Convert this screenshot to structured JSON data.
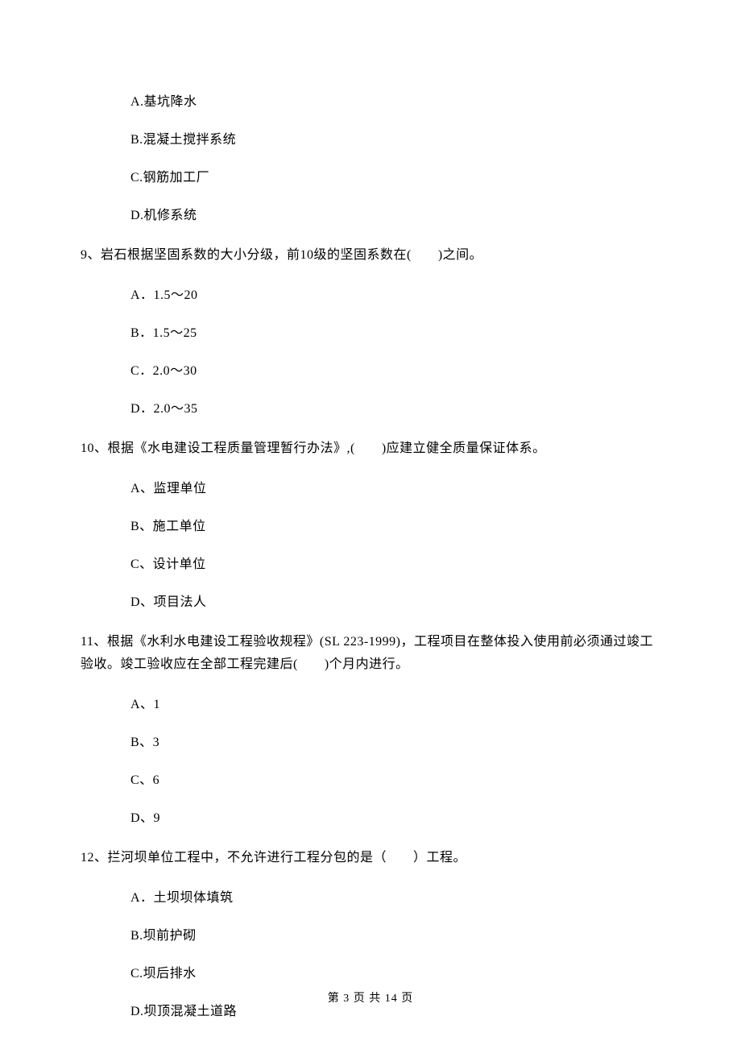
{
  "options_q8": {
    "a": "A.基坑降水",
    "b": "B.混凝土搅拌系统",
    "c": "C.钢筋加工厂",
    "d": "D.机修系统"
  },
  "q9": {
    "text": "9、岩石根据坚固系数的大小分级，前10级的坚固系数在(　　)之间。",
    "a": "A．1.5～20",
    "b": "B．1.5～25",
    "c": "C．2.0～30",
    "d": "D．2.0～35"
  },
  "q10": {
    "text": "10、根据《水电建设工程质量管理暂行办法》,(　　)应建立健全质量保证体系。",
    "a": "A、监理单位",
    "b": "B、施工单位",
    "c": "C、设计单位",
    "d": "D、项目法人"
  },
  "q11": {
    "text": "11、根据《水利水电建设工程验收规程》(SL 223-1999)，工程项目在整体投入使用前必须通过竣工验收。竣工验收应在全部工程完建后(　　)个月内进行。",
    "a": "A、1",
    "b": "B、3",
    "c": "C、6",
    "d": "D、9"
  },
  "q12": {
    "text": "12、拦河坝单位工程中，不允许进行工程分包的是（　　）工程。",
    "a": "A．土坝坝体填筑",
    "b": "B.坝前护砌",
    "c": "C.坝后排水",
    "d": "D.坝顶混凝土道路"
  },
  "footer": "第 3 页 共 14 页"
}
